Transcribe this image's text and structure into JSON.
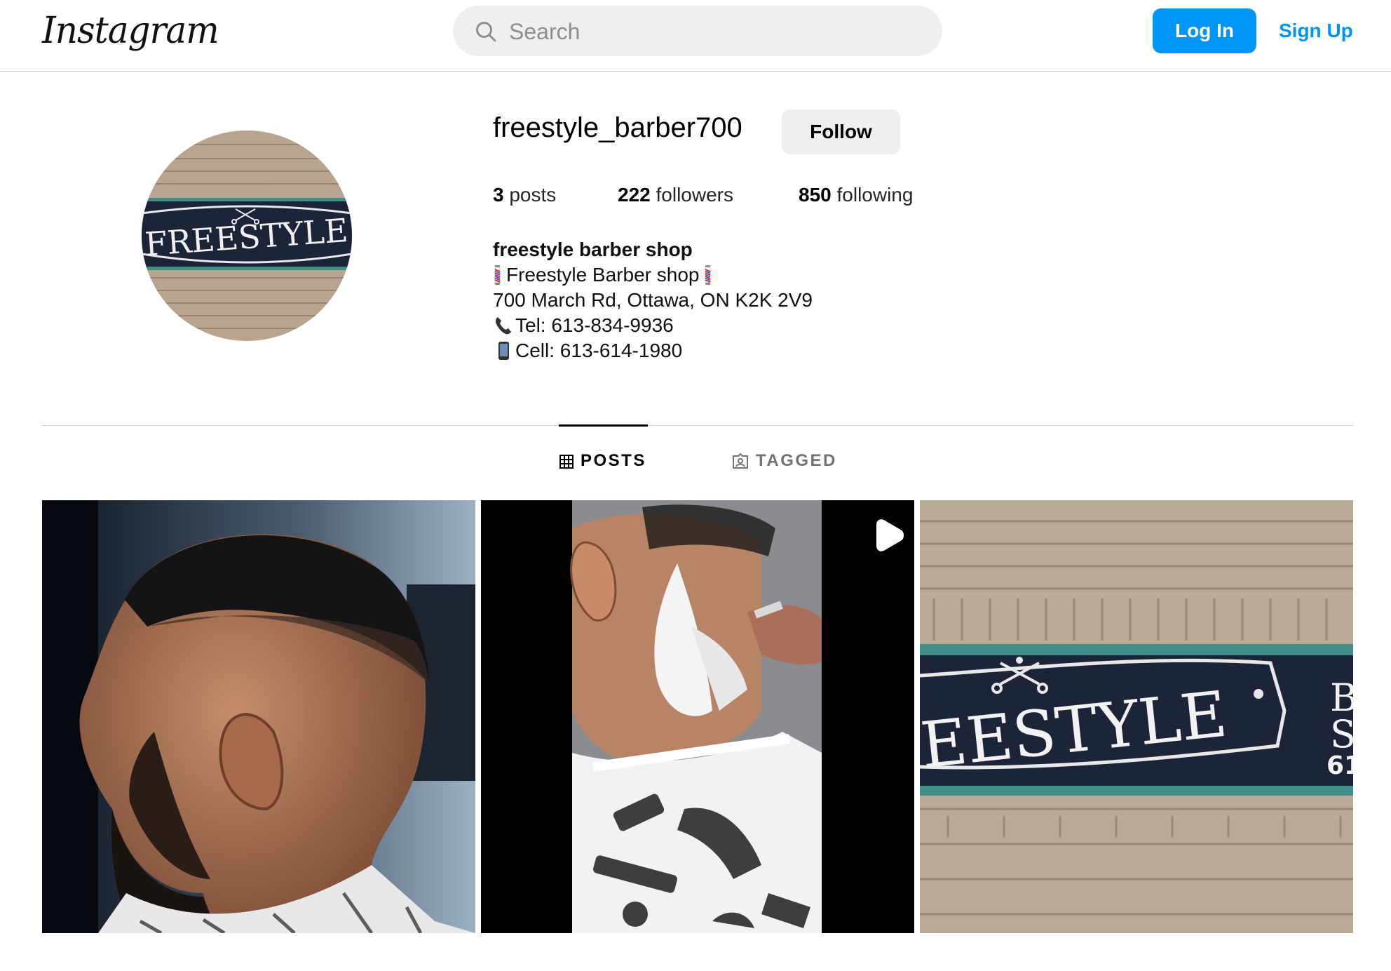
{
  "header": {
    "logo": "Instagram",
    "search_placeholder": "Search",
    "login_label": "Log In",
    "signup_label": "Sign Up"
  },
  "profile": {
    "username": "freestyle_barber700",
    "follow_label": "Follow",
    "stats": {
      "posts_count": "3",
      "posts_label": "posts",
      "followers_count": "222",
      "followers_label": "followers",
      "following_count": "850",
      "following_label": "following"
    },
    "bio": {
      "name": "freestyle barber shop",
      "line1": "Freestyle Barber shop",
      "line2": "700 March Rd, Ottawa, ON K2K 2V9",
      "line3": "Tel: 613-834-9936",
      "line4": "Cell: 613-614-1980"
    },
    "avatar_sign_text": "FREESTYLE"
  },
  "tabs": [
    {
      "label": "POSTS",
      "icon": "grid-icon",
      "active": true
    },
    {
      "label": "TAGGED",
      "icon": "tagged-icon",
      "active": false
    }
  ],
  "posts": [
    {
      "kind": "photo",
      "description_icon": "haircut-photo"
    },
    {
      "kind": "video",
      "description_icon": "shave-video"
    },
    {
      "kind": "photo",
      "sign_text": "EESTYLE",
      "sign_side_text": "B S 61"
    }
  ],
  "colors": {
    "accent": "#0095f6",
    "button_gray": "#efefef",
    "sign_navy": "#1c2437",
    "sign_teal": "#3f8f88"
  }
}
